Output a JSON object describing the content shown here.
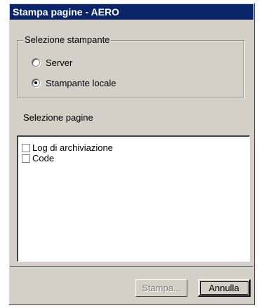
{
  "window": {
    "title": "Stampa pagine - AERO"
  },
  "printer_selection": {
    "legend": "Selezione stampante",
    "options": [
      {
        "label": "Server",
        "checked": false
      },
      {
        "label": "Stampante locale",
        "checked": true
      }
    ]
  },
  "page_selection": {
    "label": "Selezione pagine",
    "items": [
      {
        "label": "Log di archiviazione",
        "checked": false
      },
      {
        "label": "Code",
        "checked": false
      }
    ]
  },
  "buttons": {
    "print_label": "Stampa...",
    "cancel_label": "Annulla"
  },
  "colors": {
    "titlebar": "#0a246a",
    "dialog": "#d4d0c8"
  }
}
